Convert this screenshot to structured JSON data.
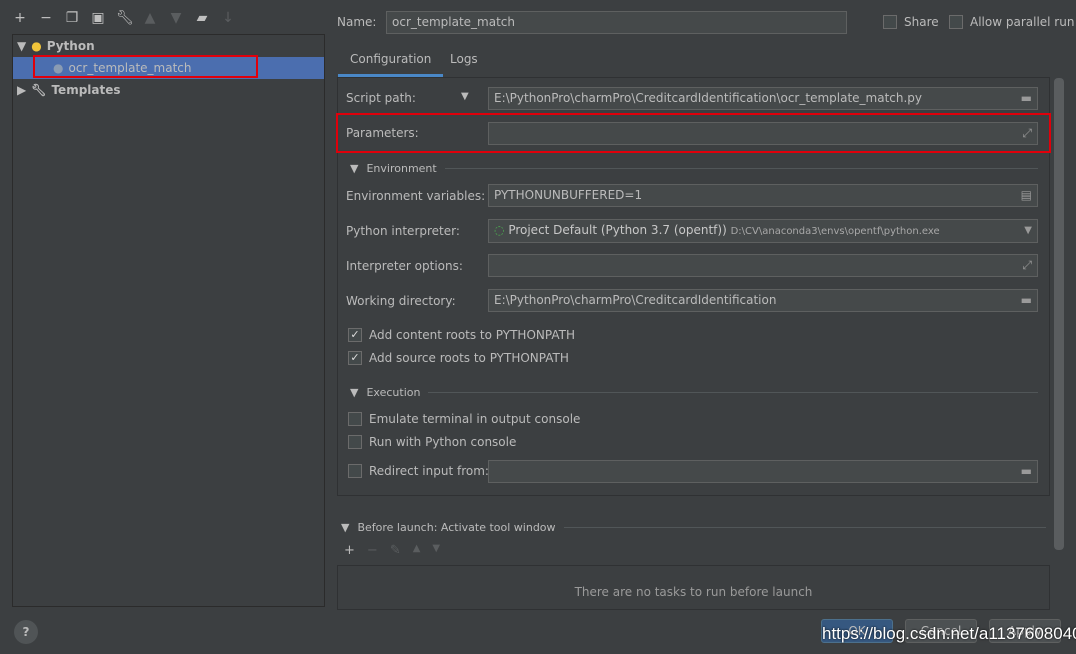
{
  "toolbar": {
    "icons": [
      "add-icon",
      "remove-icon",
      "copy-icon",
      "save-icon",
      "wrench-icon",
      "move-up-icon",
      "move-down-icon",
      "new-folder-icon",
      "sort-icon"
    ]
  },
  "tree": {
    "python": "Python",
    "config": "ocr_template_match",
    "templates": "Templates"
  },
  "header": {
    "name_label": "Name:",
    "name_value": "ocr_template_match",
    "share": "Share",
    "parallel": "Allow parallel run",
    "share_checked": false,
    "parallel_checked": false
  },
  "tabs": [
    "Configuration",
    "Logs"
  ],
  "form": {
    "script_label": "Script path:",
    "script_value": "E:\\PythonPro\\charmPro\\CreditcardIdentification\\ocr_template_match.py",
    "params_label": "Parameters:",
    "params_value": "",
    "env_section": "Environment",
    "envvars_label": "Environment variables:",
    "envvars_value": "PYTHONUNBUFFERED=1",
    "interp_label": "Python interpreter:",
    "interp_value": "Project Default (Python 3.7 (opentf))",
    "interp_path": "D:\\CV\\anaconda3\\envs\\opentf\\python.exe",
    "interp_opts_label": "Interpreter options:",
    "interp_opts_value": "",
    "workdir_label": "Working directory:",
    "workdir_value": "E:\\PythonPro\\charmPro\\CreditcardIdentification",
    "content_roots": "Add content roots to PYTHONPATH",
    "source_roots": "Add source roots to PYTHONPATH",
    "exec_section": "Execution",
    "emulate": "Emulate terminal in output console",
    "python_console": "Run with Python console",
    "redirect": "Redirect input from:",
    "redirect_value": ""
  },
  "before_launch": {
    "title": "Before launch: Activate tool window",
    "empty": "There are no tasks to run before launch"
  },
  "buttons": {
    "ok": "OK",
    "cancel": "Cancel",
    "apply": "Apply",
    "help": "?"
  },
  "watermark": "https://blog.csdn.net/a1137608040"
}
